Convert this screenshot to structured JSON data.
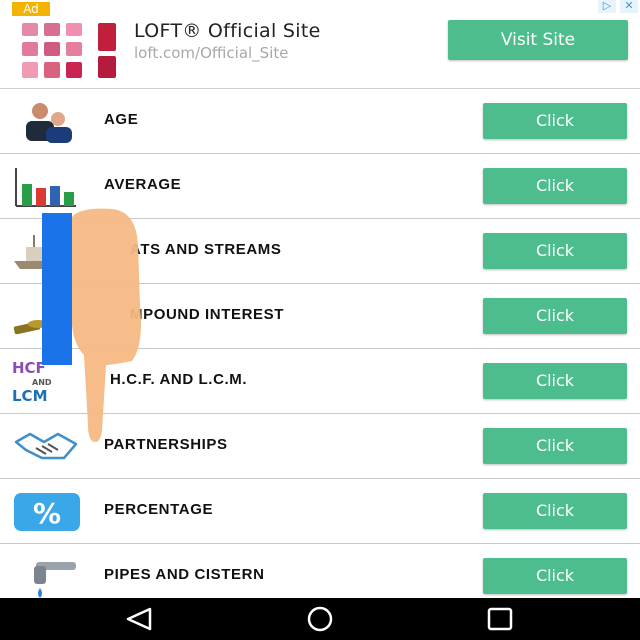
{
  "ad": {
    "badge": "Ad",
    "title": "LOFT® Official Site",
    "url": "loft.com/Official_Site",
    "cta": "Visit Site",
    "adchoices_icon": "adchoices-icon",
    "close_icon": "close-icon"
  },
  "rows": [
    {
      "label": "AGE",
      "button": "Click",
      "icon": "people-icon"
    },
    {
      "label": "AVERAGE",
      "button": "Click",
      "icon": "bar-chart-icon"
    },
    {
      "label": "ATS AND STREAMS",
      "button": "Click",
      "icon": "boat-icon"
    },
    {
      "label": "MPOUND INTEREST",
      "button": "Click",
      "icon": "money-icon"
    },
    {
      "label": "H.C.F. AND L.C.M.",
      "button": "Click",
      "icon": "hcf-lcm-icon",
      "icon_text_top": "HCF",
      "icon_text_mid": "AND",
      "icon_text_bot": "LCM"
    },
    {
      "label": "PARTNERSHIPS",
      "button": "Click",
      "icon": "handshake-icon"
    },
    {
      "label": "PERCENTAGE",
      "button": "Click",
      "icon": "percent-icon",
      "icon_text": "%"
    },
    {
      "label": "PIPES AND CISTERN",
      "button": "Click",
      "icon": "faucet-icon"
    }
  ],
  "colors": {
    "accent": "#4dbd8e",
    "ad_badge": "#f2b400",
    "pointer_blue": "#1a73e8",
    "pointer_skin": "#f6b884"
  },
  "navbar": {
    "back": "back-icon",
    "home": "home-icon",
    "recents": "recents-icon"
  }
}
